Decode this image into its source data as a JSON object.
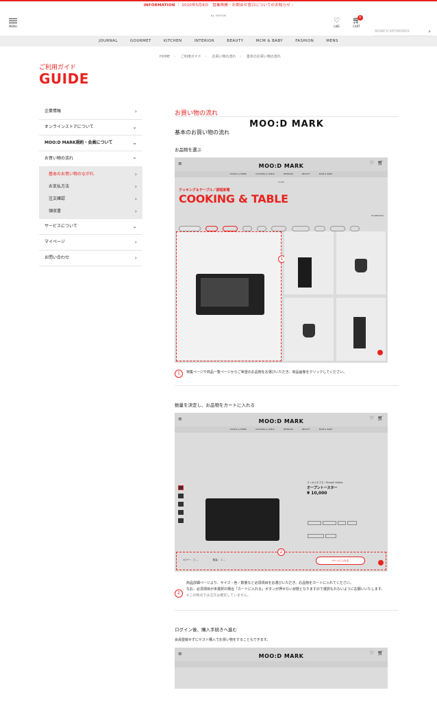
{
  "info_bar": {
    "label": "INFORMATION",
    "text": "2020年5月8日　営業再開・お問合せ窓口についてのお知らせ",
    "arrow": "›"
  },
  "header": {
    "menu_label": "MENU",
    "logo": "MOO:D MARK",
    "logo_sub": "by ISETAN",
    "like_label": "LIKE",
    "cart_label": "CART",
    "cart_count": "0",
    "search_placeholder": "SEARCH KEYWORDS"
  },
  "gnav": [
    "JOURNAL",
    "GOURMET",
    "KITCHEN",
    "INTERIOR",
    "BEAUTY",
    "MCM & BABY",
    "FASHION",
    "MENS"
  ],
  "breadcrumb": [
    "HOME",
    "ご利用ガイド",
    "お買い物の流れ",
    "基本のお買い物の流れ"
  ],
  "guide": {
    "jp": "ご利用ガイド",
    "en": "GUIDE"
  },
  "sidebar": {
    "items_top": [
      {
        "label": "企業情報",
        "chev": "›"
      },
      {
        "label": "オンラインストアについて",
        "chev": "⌄"
      },
      {
        "label": "MOO:D MARK規約・会員について",
        "chev": "⌄"
      },
      {
        "label": "お買い物の流れ",
        "chev": "⌄"
      }
    ],
    "sub_items": [
      {
        "label": "基本のお買い物のながれ",
        "chev": "›"
      },
      {
        "label": "お支払方法",
        "chev": "›"
      },
      {
        "label": "注文確認",
        "chev": "›"
      },
      {
        "label": "領収書",
        "chev": "›"
      }
    ],
    "items_bottom": [
      {
        "label": "サービスについて",
        "chev": "⌄"
      },
      {
        "label": "マイページ",
        "chev": "›"
      },
      {
        "label": "お問い合わせ",
        "chev": "›"
      }
    ]
  },
  "main": {
    "page_title": "お買い物の流れ",
    "section_title": "基本のお買い物の流れ",
    "step1": {
      "heading": "お品物を選ぶ",
      "num": "1",
      "note": "特集ページや商品一覧ページからご希望のお品物をお選びいただき、商品画像をクリックしてください。",
      "shot": {
        "banner_jp": "クッキング＆テーブル／調理家電",
        "banner_en": "COOKING & TABLE",
        "results": "50 RESULTS",
        "home_crumb": "HOME",
        "nav": [
          "FOODS & DRINK",
          "COOKING & TABLE",
          "INTERIOR",
          "BEAUTY",
          "MOM & BABY"
        ]
      }
    },
    "step2": {
      "heading": "数量を決定し、お品物をカートに入れる",
      "num": "2",
      "note1": "商品詳細ページより、サイズ・色・数量など必須項目をお選びいただき、お品物をカートに入れてください。",
      "note2": "なお、必須項目が未選択の場合「カートに入れる」ボタンが押せない状態となりますので選択もれないようにお願いいたします。",
      "note3": "※この時点では注文は確定していません。",
      "shot": {
        "brand": "ラッセルホブス｜Russell Hobbs",
        "product": "オーブントースター",
        "price": "¥ 10,000",
        "color_label": "カラー：",
        "qty_label": "数量：",
        "qty": "1",
        "cart_btn": "カートに入れる"
      }
    },
    "step3": {
      "heading": "ログイン後、購入手続きへ進む",
      "note": "会員登録せずにゲスト購入でお買い物をすることもできます。"
    }
  }
}
